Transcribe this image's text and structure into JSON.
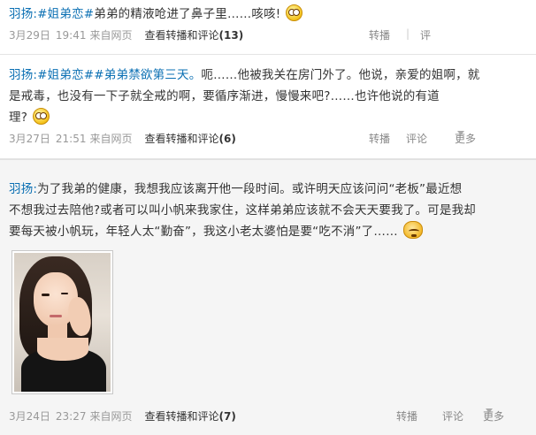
{
  "posts": [
    {
      "author": "羽扬:",
      "topic": "#姐弟恋#",
      "text": "弟弟的精液呛进了鼻子里……咳咳!",
      "emoji": "surprised-emoji",
      "date": "3月29日",
      "time": "19:41",
      "source": "来自网页",
      "view_label": "查看转播和评论",
      "view_count": "(13)",
      "repost": "转播",
      "separator": "|",
      "comment": "评"
    },
    {
      "author": "羽扬:",
      "topic1": "#姐弟恋#",
      "topic2": "#弟弟禁欲第三天。",
      "line1": "呃……他被我关在房门外了。他说，亲爱的姐啊，就",
      "line2": "是戒毒，也没有一下子就全戒的啊，要循序渐进，慢慢来吧?……也许他说的有道",
      "line3": "理?",
      "emoji": "crying-emoji",
      "date": "3月27日",
      "time": "21:51",
      "source": "来自网页",
      "view_label": "查看转播和评论",
      "view_count": "(6)",
      "repost": "转播",
      "comment": "评论",
      "more": "更多"
    },
    {
      "author": "羽扬:",
      "line1": "为了我弟的健康，我想我应该离开他一段时间。或许明天应该问问“老板”最近想",
      "line2": "不想我过去陪他?或者可以叫小帆来我家住，这样弟弟应该就不会天天要我了。可是我却",
      "line3": "要每天被小帆玩，年轻人太“勤奋”，我这小老太婆怕是要“吃不消”了……",
      "emoji": "sweat-emoji",
      "date": "3月24日",
      "time": "23:27",
      "source": "来自网页",
      "view_label": "查看转播和评论",
      "view_count": "(7)",
      "repost": "转播",
      "comment": "评论",
      "more": "更多"
    }
  ]
}
